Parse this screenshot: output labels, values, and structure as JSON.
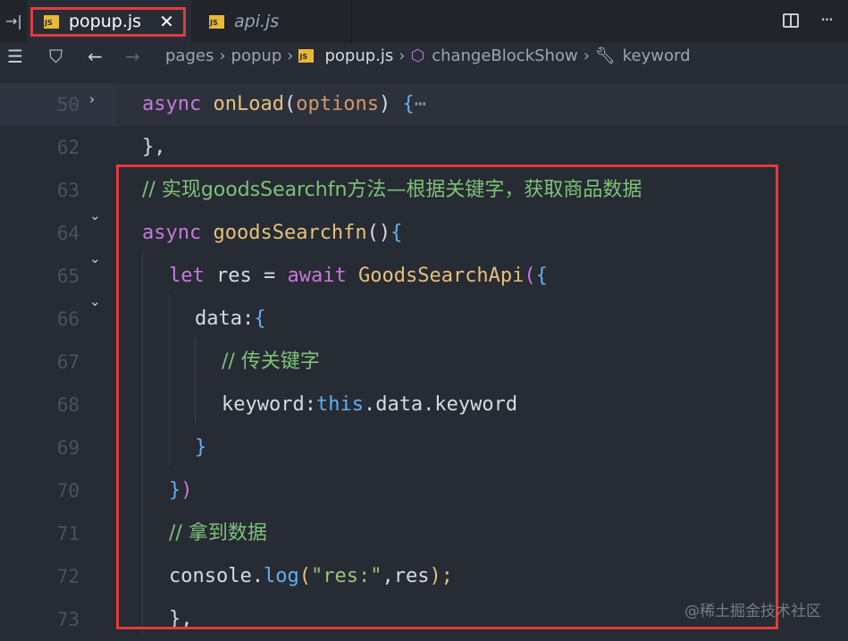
{
  "tabs": [
    {
      "label": "popup.js",
      "badge": "JS",
      "close": "✕",
      "active": true
    },
    {
      "label": "api.js",
      "badge": "JS",
      "active": false
    }
  ],
  "breadcrumb": {
    "items": [
      "pages",
      "popup",
      "popup.js",
      "changeBlockShow",
      "keyword"
    ],
    "file_badge": "JS"
  },
  "code_lines": [
    {
      "num": "50",
      "fold": "›"
    },
    {
      "num": "62"
    },
    {
      "num": "63"
    },
    {
      "num": "64",
      "fold": "⌄"
    },
    {
      "num": "65",
      "fold": "⌄"
    },
    {
      "num": "66",
      "fold": "⌄"
    },
    {
      "num": "67"
    },
    {
      "num": "68"
    },
    {
      "num": "69"
    },
    {
      "num": "70"
    },
    {
      "num": "71"
    },
    {
      "num": "72"
    },
    {
      "num": "73"
    }
  ],
  "code": {
    "l50": {
      "kw": "async",
      "fn": "onLoad",
      "open": "(",
      "param": "options",
      "close": ")",
      "brace": "{",
      "ellipsis": "⋯"
    },
    "l62": {
      "text": "},"
    },
    "l63": {
      "comment": "// 实现goodsSearchfn方法—根据关键字，获取商品数据"
    },
    "l64": {
      "kw": "async",
      "fn": "goodsSearchfn",
      "paren": "()",
      "brace": "{"
    },
    "l65": {
      "kw": "let",
      "var": "res",
      "eq": "=",
      "kw2": "await",
      "fn": "GoodsSearchApi",
      "open": "(",
      "brace": "{"
    },
    "l66": {
      "key": "data",
      "colon": ":",
      "brace": "{"
    },
    "l67": {
      "comment": "// 传关键字"
    },
    "l68": {
      "key": "keyword",
      "colon": ":",
      "this": "this",
      "rest": ".data.keyword"
    },
    "l69": {
      "brace": "}"
    },
    "l70": {
      "brace": "}",
      "paren": ")"
    },
    "l71": {
      "comment": "// 拿到数据"
    },
    "l72": {
      "obj": "console",
      "dot": ".",
      "fn": "log",
      "open": "(",
      "str": "\"res:\"",
      "rest": ",res",
      "close": ");"
    },
    "l73": {
      "text": "},"
    }
  },
  "watermark": "@稀土掘金技术社区",
  "colors": {
    "highlight_box": "#e03c3c",
    "js_badge": "#e8b938"
  }
}
